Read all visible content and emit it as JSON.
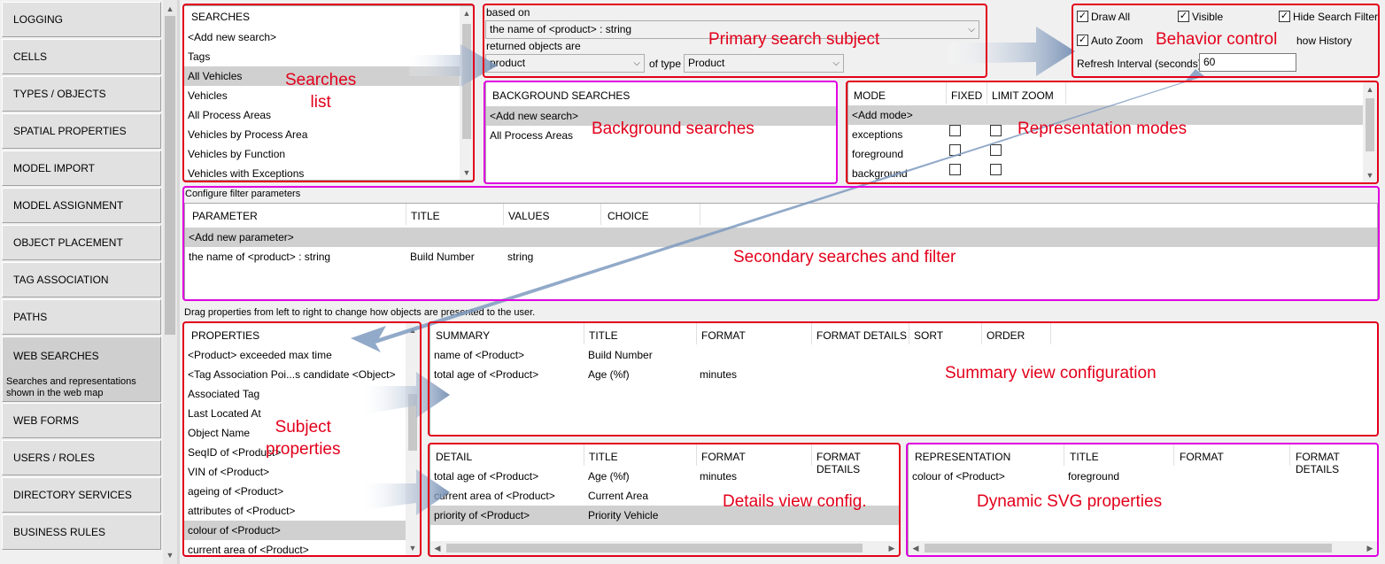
{
  "sidebar": {
    "items": [
      {
        "label": "LOGGING"
      },
      {
        "label": "CELLS"
      },
      {
        "label": "TYPES / OBJECTS"
      },
      {
        "label": "SPATIAL PROPERTIES"
      },
      {
        "label": "MODEL IMPORT"
      },
      {
        "label": "MODEL ASSIGNMENT"
      },
      {
        "label": "OBJECT PLACEMENT"
      },
      {
        "label": "TAG ASSOCIATION"
      },
      {
        "label": "PATHS"
      },
      {
        "label": "WEB SEARCHES",
        "subtitle": "Searches and representations shown in the web map"
      },
      {
        "label": "WEB FORMS"
      },
      {
        "label": "USERS / ROLES"
      },
      {
        "label": "DIRECTORY SERVICES"
      },
      {
        "label": "BUSINESS RULES"
      }
    ]
  },
  "searches": {
    "header": "SEARCHES",
    "items": [
      "<Add new search>",
      "Tags",
      "All Vehicles",
      "Vehicles",
      "All Process Areas",
      "Vehicles by Process Area",
      "Vehicles by Function",
      "Vehicles with Exceptions"
    ],
    "selected": "All Vehicles"
  },
  "primary": {
    "based_on_label": "based on",
    "based_on_value": "the name of <product> : string",
    "returned_label": "returned objects are",
    "returned_value": "product",
    "of_type_label": "of type",
    "of_type_value": "Product"
  },
  "behavior": {
    "draw_all": "Draw All",
    "visible": "Visible",
    "hide_search_filter": "Hide Search Filter",
    "auto_zoom": "Auto Zoom",
    "show_history": "how History",
    "refresh_label": "Refresh Interval (seconds)",
    "refresh_value": "60"
  },
  "background": {
    "header": "BACKGROUND SEARCHES",
    "items": [
      "<Add new search>",
      "All Process Areas"
    ]
  },
  "modes": {
    "headers": {
      "mode": "MODE",
      "fixed": "FIXED",
      "limit_zoom": "LIMIT ZOOM"
    },
    "add": "<Add mode>",
    "rows": [
      "exceptions",
      "foreground",
      "background"
    ]
  },
  "filter": {
    "caption": "Configure filter parameters",
    "headers": {
      "parameter": "PARAMETER",
      "title": "TITLE",
      "values": "VALUES",
      "choice": "CHOICE"
    },
    "add": "<Add new parameter>",
    "rows": [
      {
        "parameter": "the name of <product> : string",
        "title": "Build Number",
        "values": "string",
        "choice": ""
      }
    ]
  },
  "drag_hint": "Drag properties from left to right to change how objects are presented to the user.",
  "properties": {
    "header": "PROPERTIES",
    "items": [
      "<Product> exceeded max time",
      "<Tag Association Poi...s candidate <Object>",
      "Associated Tag",
      "Last Located At",
      "Object Name",
      "SeqID of <Product>",
      "VIN of <Product>",
      "ageing of <Product>",
      "attributes of <Product>",
      "colour of <Product>",
      "current area of <Product>"
    ],
    "selected": "colour of <Product>"
  },
  "summary": {
    "headers": {
      "summary": "SUMMARY",
      "title": "TITLE",
      "format": "FORMAT",
      "format_details": "FORMAT DETAILS",
      "sort": "SORT",
      "order": "ORDER"
    },
    "rows": [
      {
        "summary": "name of <Product>",
        "title": "Build Number",
        "format": ""
      },
      {
        "summary": "total age of <Product>",
        "title": "Age (%f)",
        "format": "minutes"
      }
    ]
  },
  "detail": {
    "headers": {
      "detail": "DETAIL",
      "title": "TITLE",
      "format": "FORMAT",
      "format_details": "FORMAT DETAILS"
    },
    "rows": [
      {
        "detail": "total age of <Product>",
        "title": "Age (%f)",
        "format": "minutes"
      },
      {
        "detail": "current area of <Product>",
        "title": "Current Area",
        "format": ""
      },
      {
        "detail": "priority of <Product>",
        "title": "Priority Vehicle",
        "format": ""
      }
    ]
  },
  "representation": {
    "headers": {
      "representation": "REPRESENTATION",
      "title": "TITLE",
      "format": "FORMAT",
      "format_details": "FORMAT DETAILS"
    },
    "rows": [
      {
        "representation": "colour of <Product>",
        "title": "foreground"
      }
    ]
  },
  "annotations": {
    "searches_list": "Searches\nlist",
    "primary": "Primary search subject",
    "behavior": "Behavior control",
    "background": "Background searches",
    "modes": "Representation modes",
    "secondary": "Secondary searches and filter",
    "summary": "Summary view configuration",
    "subject": "Subject\nproperties",
    "details": "Details view config.",
    "svg": "Dynamic SVG properties"
  },
  "colors": {
    "annotation_red": "#e3001b",
    "annotation_magenta": "#e000e0",
    "arrow": "#7f9bbf"
  }
}
